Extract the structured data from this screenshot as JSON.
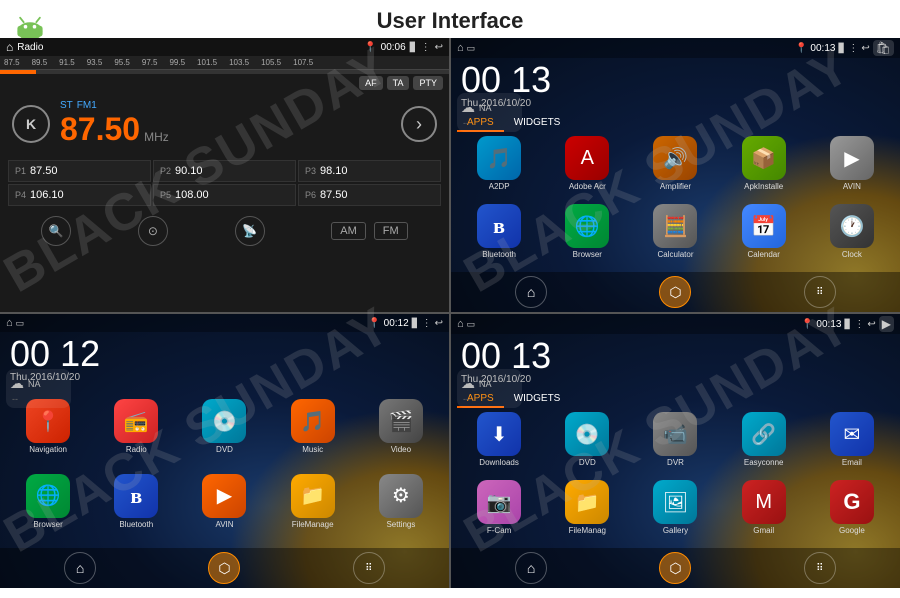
{
  "page": {
    "title": "User Interface",
    "android_version": "Android"
  },
  "header": {
    "title": "User Interface"
  },
  "radio": {
    "title": "Radio",
    "time": "00:06",
    "freq_display": "87.50",
    "unit": "MHz",
    "mode": "FM1",
    "stereo": "ST",
    "station_key": "K",
    "buttons": [
      "AF",
      "TA",
      "PTY"
    ],
    "presets": [
      {
        "label": "P1",
        "value": "87.50"
      },
      {
        "label": "P2",
        "value": "90.10"
      },
      {
        "label": "P3",
        "value": "98.10"
      },
      {
        "label": "P4",
        "value": "106.10"
      },
      {
        "label": "P5",
        "value": "108.00"
      },
      {
        "label": "P6",
        "value": "87.50"
      }
    ],
    "band_am": "AM",
    "band_fm": "FM",
    "freq_marks": [
      "87.5",
      "89.5",
      "91.5",
      "93.5",
      "95.5",
      "97.5",
      "99.5",
      "101.5",
      "103.5",
      "105.5",
      "107.5"
    ]
  },
  "quad_tr": {
    "time": "00:13",
    "clock_hr": "00",
    "clock_min": "13",
    "date": "Thu,2016/10/20",
    "tabs": [
      "APPS",
      "WIDGETS"
    ],
    "active_tab": "APPS",
    "apps_row1": [
      {
        "label": "A2DP",
        "icon_class": "ic-a2dp",
        "icon": "🎵"
      },
      {
        "label": "Adobe Acr",
        "icon_class": "ic-adobe",
        "icon": "📄"
      },
      {
        "label": "Amplifier",
        "icon_class": "ic-amplifier",
        "icon": "🔊"
      },
      {
        "label": "ApkInstalle",
        "icon_class": "ic-apk",
        "icon": "📦"
      },
      {
        "label": "AVIN",
        "icon_class": "ic-avin",
        "icon": "📹"
      }
    ],
    "apps_row2": [
      {
        "label": "Bluetooth",
        "icon_class": "ic-bluetooth",
        "icon": "🔵"
      },
      {
        "label": "Browser",
        "icon_class": "ic-browser",
        "icon": "🌐"
      },
      {
        "label": "Calculator",
        "icon_class": "ic-calc",
        "icon": "🧮"
      },
      {
        "label": "Calendar",
        "icon_class": "ic-calendar",
        "icon": "📅"
      },
      {
        "label": "Clock",
        "icon_class": "ic-clock",
        "icon": "🕐"
      }
    ]
  },
  "quad_bl": {
    "time": "00:12",
    "clock_hr": "00",
    "clock_min": "12",
    "date": "Thu,2016/10/20",
    "apps_row1": [
      {
        "label": "Navigation",
        "icon_class": "ic-navigation",
        "icon": "📍"
      },
      {
        "label": "Radio",
        "icon_class": "ic-radio",
        "icon": "📻"
      },
      {
        "label": "DVD",
        "icon_class": "ic-dvd",
        "icon": "💿"
      },
      {
        "label": "Music",
        "icon_class": "ic-music",
        "icon": "🎵"
      },
      {
        "label": "Video",
        "icon_class": "ic-video",
        "icon": "🎬"
      }
    ],
    "apps_row2": [
      {
        "label": "Browser",
        "icon_class": "ic-browser",
        "icon": "🌐"
      },
      {
        "label": "Bluetooth",
        "icon_class": "ic-bluetooth2",
        "icon": "🔵"
      },
      {
        "label": "AVIN",
        "icon_class": "ic-avin2",
        "icon": "📹"
      },
      {
        "label": "FileManage",
        "icon_class": "ic-file",
        "icon": "📁"
      },
      {
        "label": "Settings",
        "icon_class": "ic-settings",
        "icon": "⚙️"
      }
    ]
  },
  "quad_br": {
    "time": "00:13",
    "clock_hr": "00",
    "clock_min": "13",
    "date": "Thu,2016/10/20",
    "tabs": [
      "APPS",
      "WIDGETS"
    ],
    "active_tab": "APPS",
    "apps_row1": [
      {
        "label": "Downloads",
        "icon_class": "ic-downloads",
        "icon": "⬇️"
      },
      {
        "label": "DVD",
        "icon_class": "ic-dvd",
        "icon": "💿"
      },
      {
        "label": "DVR",
        "icon_class": "ic-dvr",
        "icon": "📹"
      },
      {
        "label": "Easyconne",
        "icon_class": "ic-easyconn",
        "icon": "🔗"
      },
      {
        "label": "Email",
        "icon_class": "ic-email",
        "icon": "✉️"
      }
    ],
    "apps_row2": [
      {
        "label": "F-Cam",
        "icon_class": "ic-fcam",
        "icon": "📷"
      },
      {
        "label": "FileManag",
        "icon_class": "ic-filemanag",
        "icon": "📁"
      },
      {
        "label": "Gallery",
        "icon_class": "ic-gallery",
        "icon": "🖼️"
      },
      {
        "label": "Gmail",
        "icon_class": "ic-gmail",
        "icon": "📧"
      },
      {
        "label": "Google",
        "icon_class": "ic-google",
        "icon": "G"
      }
    ]
  },
  "watermarks": [
    "BLACK SUNDAY",
    "BLACK SUNDAY",
    "BLACK SUNDAY",
    "BLACK SUNDAY"
  ]
}
